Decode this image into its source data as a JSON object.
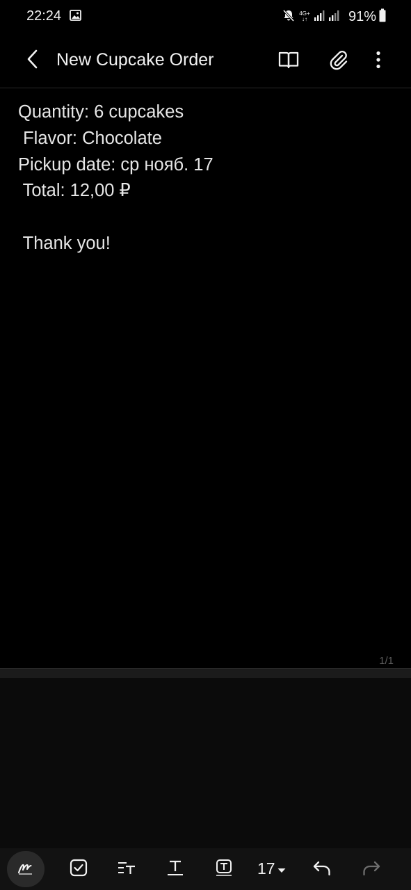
{
  "status_bar": {
    "time": "22:24",
    "network": "4G+",
    "battery": "91%"
  },
  "app_bar": {
    "title": "New Cupcake Order"
  },
  "note": {
    "lines": [
      "Quantity: 6 cupcakes",
      " Flavor: Chocolate",
      "Pickup date: ср нояб. 17",
      " Total: 12,00 ₽",
      "",
      " Thank you!"
    ]
  },
  "page_indicator": "1/1",
  "toolbar": {
    "font_size": "17"
  },
  "colors": {
    "background": "#000000",
    "text": "#e6e6e6",
    "toolbar": "#121212",
    "disabled": "#6e6e6e"
  },
  "icons": [
    "gallery-icon",
    "mute-icon",
    "signal-icon",
    "battery-icon",
    "back-arrow-icon",
    "reading-mode-icon",
    "attach-icon",
    "more-options-icon",
    "pen-icon",
    "checkbox-icon",
    "paragraph-style-icon",
    "text-style-icon",
    "text-box-icon",
    "chevron-down-icon",
    "undo-icon",
    "redo-icon"
  ]
}
